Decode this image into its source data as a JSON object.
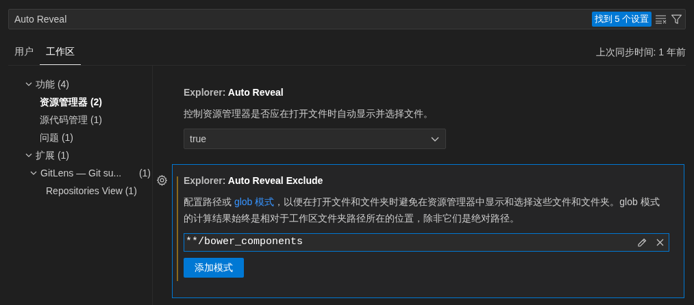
{
  "search": {
    "value": "Auto Reveal",
    "badge": "找到 5 个设置"
  },
  "tabs": [
    {
      "label": "用户",
      "selected": false
    },
    {
      "label": "工作区",
      "selected": true
    }
  ],
  "sync_status": "上次同步时间: 1 年前",
  "toc": [
    {
      "label": "功能 (4)",
      "expanded": true,
      "selected": false,
      "children": [
        {
          "label": "资源管理器 (2)",
          "selected": true
        },
        {
          "label": "源代码管理 (1)",
          "selected": false
        },
        {
          "label": "问题 (1)",
          "selected": false
        }
      ]
    },
    {
      "label": "扩展 (1)",
      "expanded": true,
      "selected": false,
      "children": [
        {
          "label": "GitLens — Git su...",
          "count": "(1)",
          "expanded": true,
          "selected": false,
          "children": [
            {
              "label": "Repositories View (1)",
              "selected": false
            }
          ]
        }
      ]
    }
  ],
  "settings": [
    {
      "kind": "dropdown",
      "category": "Explorer: ",
      "name": "Auto Reveal",
      "focused": false,
      "modified": false,
      "description": [
        {
          "text": "控制资源管理器是否应在打开文件时自动显示并选择文件。"
        }
      ],
      "value": "true"
    },
    {
      "kind": "list",
      "category": "Explorer: ",
      "name": "Auto Reveal Exclude",
      "focused": true,
      "modified": true,
      "description": [
        {
          "text": "配置路径或 "
        },
        {
          "text": "glob 模式",
          "link": true
        },
        {
          "text": "，以便在打开文件和文件夹时避免在资源管理器中显示和选择这些文件和文件夹。glob 模式的计算结果始终是相对于工作区文件夹路径所在的位置，除非它们是绝对路径。"
        }
      ],
      "items": [
        {
          "value": "**/bower_components"
        }
      ],
      "add_button": "添加模式"
    }
  ]
}
